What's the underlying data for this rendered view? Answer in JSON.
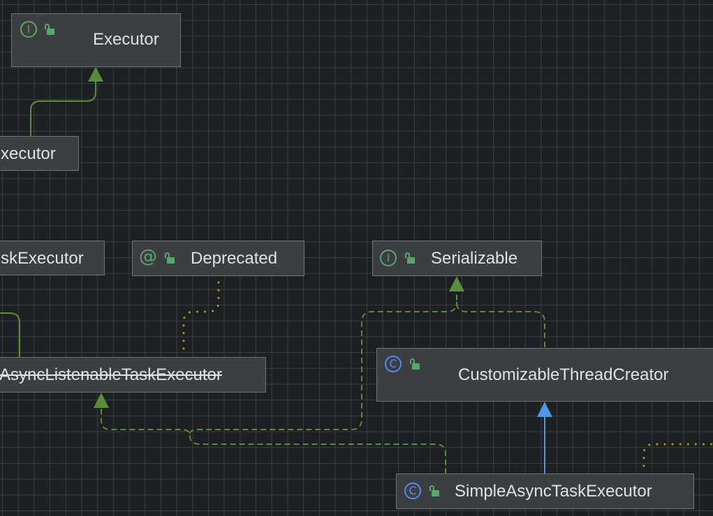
{
  "nodes": {
    "executor": {
      "label": "Executor",
      "kind": "interface",
      "badge": "I"
    },
    "task_executor": {
      "label": "xecutor"
    },
    "async_task_executor": {
      "label": "skExecutor"
    },
    "deprecated": {
      "label": "Deprecated",
      "kind": "annotation",
      "badge": "@"
    },
    "serializable": {
      "label": "Serializable",
      "kind": "interface",
      "badge": "I"
    },
    "async_listenable": {
      "label": "AsyncListenableTaskExecutor",
      "deprecated": true
    },
    "customizable_thread_creator": {
      "label": "CustomizableThreadCreator",
      "kind": "class",
      "badge": "C"
    },
    "simple_async_task_executor": {
      "label": "SimpleAsyncTaskExecutor",
      "kind": "class",
      "badge": "C"
    }
  },
  "colors": {
    "background": "#1e1f22",
    "grid": "#3a3c41",
    "node_fill": "#3c3e42",
    "node_border": "#6f7276",
    "text": "#dfe1e5",
    "interface_edge": "#5b8c3a",
    "extends_edge": "#4e95e8",
    "annotation_edge": "#a9a40c"
  },
  "icons": {
    "interface": "interface-icon",
    "class": "class-icon",
    "annotation": "annotation-icon",
    "access": "unlocked-icon"
  }
}
